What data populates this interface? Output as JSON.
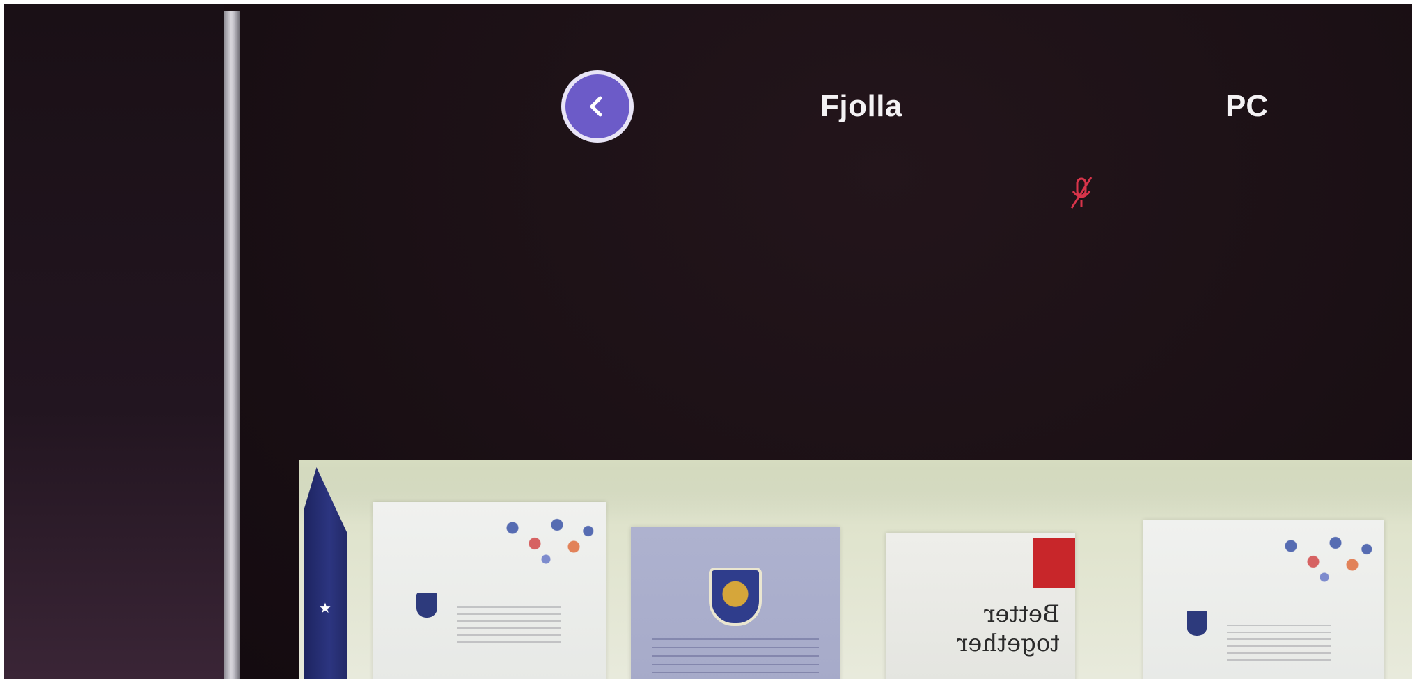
{
  "call": {
    "participant_name": "Fjolla",
    "device_label": "PC"
  },
  "controls": {
    "back_icon": "chevron-left-icon",
    "mic_status_icon": "mic-muted-icon"
  },
  "video": {
    "banner_text": "Better together"
  },
  "colors": {
    "accent": "#6c5bc8",
    "muted_red": "#d8344a",
    "background": "#1b1015"
  }
}
